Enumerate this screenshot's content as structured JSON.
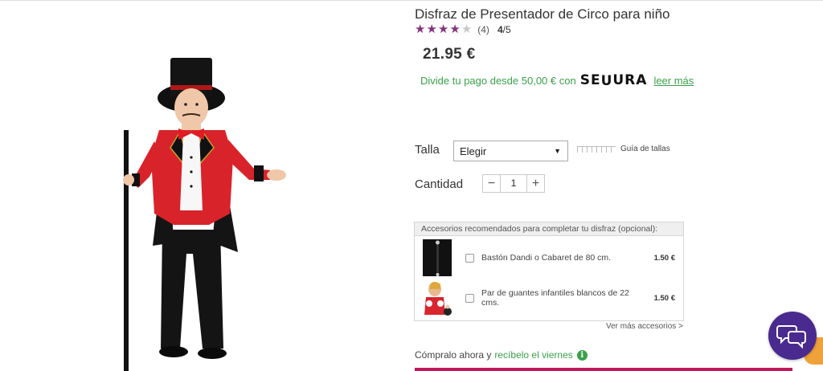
{
  "product": {
    "title": "Disfraz de Presentador de Circo para niño",
    "rating": {
      "value": 4,
      "max": 5,
      "review_count": "(4)",
      "score_value": "4",
      "score_max": "/5"
    },
    "price": "21.95 €"
  },
  "financing": {
    "text": "Divide tu pago desde 50,00 € con",
    "logo_text_a": "SE",
    "logo_text_b": "U",
    "logo_text_c": "URA",
    "link": "leer más"
  },
  "size": {
    "label": "Talla",
    "selected": "Elegir",
    "guide": "Guía de tallas"
  },
  "quantity": {
    "label": "Cantidad",
    "value": "1",
    "minus": "−",
    "plus": "+"
  },
  "accessories": {
    "header": "Accesorios recomendados para completar tu disfraz (opcional):",
    "items": [
      {
        "name": "Bastón Dandi o Cabaret de 80 cm.",
        "price": "1.50 €"
      },
      {
        "name": "Par de guantes infantiles blancos de 22 cms.",
        "price": "1.50 €"
      }
    ],
    "more": "Ver más accesorios >"
  },
  "delivery": {
    "text": "Cómpralo ahora y",
    "highlight": "recíbelo el viernes",
    "info": "i"
  },
  "colors": {
    "accent": "#86327b",
    "green": "#3aa04b",
    "cart": "#c2185b",
    "chat": "#4a2a8f"
  },
  "icons": {
    "chat": "chat-bubbles-icon",
    "info": "info-icon",
    "size_guide": "ruler-icon"
  }
}
